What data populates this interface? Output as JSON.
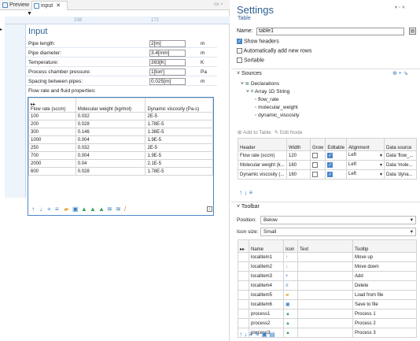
{
  "tabs": [
    {
      "label": "Preview"
    },
    {
      "label": "input"
    }
  ],
  "ruler": {
    "a": "238",
    "b": "172"
  },
  "form": {
    "title": "Input",
    "rows": [
      {
        "label": "Pipe length:",
        "value": "2[m]",
        "unit": "m"
      },
      {
        "label": "Pipe diameter:",
        "value": "3.4[mm]",
        "unit": "m"
      },
      {
        "label": "Temperature:",
        "value": "393[K]",
        "unit": "K"
      },
      {
        "label": "Process chamber pressure:",
        "value": "1[torr]",
        "unit": "Pa"
      },
      {
        "label": "Spacing between pipes:",
        "value": "0.025[m]",
        "unit": "m"
      }
    ],
    "flow_label": "Flow rate and fluid properties:"
  },
  "table": {
    "headers": [
      "Flow rate (sccm)",
      "Molecular weight (kg/mol)",
      "Dynamic viscosity (Pa-s)"
    ],
    "rows": [
      [
        "100",
        "0.032",
        "2E-5"
      ],
      [
        "200",
        "0.028",
        "1.78E-5"
      ],
      [
        "300",
        "0.146",
        "1.38E-5"
      ],
      [
        "1000",
        "0.004",
        "1.9E-5"
      ],
      [
        "250",
        "0.032",
        "2E-5"
      ],
      [
        "700",
        "0.004",
        "1.9E-5"
      ],
      [
        "2000",
        "0.04",
        "2.1E-5"
      ],
      [
        "600",
        "0.028",
        "1.78E-5"
      ]
    ]
  },
  "settings": {
    "title": "Settings",
    "subtitle": "Table",
    "name_label": "Name:",
    "name_value": "table1",
    "show_headers": "Show headers",
    "auto_add": "Automatically add new rows",
    "sortable": "Sortable",
    "sources": "Sources",
    "declarations": "Declarations",
    "array": "Array 1D String",
    "vars": [
      "flow_rate",
      "molecular_weight",
      "dynamic_viscosity"
    ],
    "add_to_table": "Add to Table",
    "edit_node": "Edit Node",
    "col_headers": [
      "Header",
      "Width",
      "Grow",
      "Editable",
      "Alignment",
      "Data source"
    ],
    "cols": [
      {
        "header": "Flow rate (sccm)",
        "width": "120",
        "align": "Left",
        "src": "Data 'flow_..."
      },
      {
        "header": "Molecular weight (k...",
        "width": "160",
        "align": "Left",
        "src": "Data 'mole..."
      },
      {
        "header": "Dynamic viscosity (...",
        "width": "160",
        "align": "Left",
        "src": "Data 'dyna..."
      }
    ],
    "toolbar": "Toolbar",
    "position_label": "Position:",
    "position_value": "Below",
    "iconsize_label": "Icon size:",
    "iconsize_value": "Small",
    "tb_headers": [
      "Name",
      "Icon",
      "Text",
      "Tooltip"
    ],
    "tb_rows": [
      {
        "name": "localitem1",
        "icon": "↑",
        "tip": "Move up"
      },
      {
        "name": "localitem2",
        "icon": "↓",
        "tip": "Move down"
      },
      {
        "name": "localitem3",
        "icon": "+",
        "tip": "Add"
      },
      {
        "name": "localitem4",
        "icon": "≡",
        "tip": "Delete"
      },
      {
        "name": "localitem5",
        "icon": "▰",
        "tip": "Load from file"
      },
      {
        "name": "localitem6",
        "icon": "▣",
        "tip": "Save to file"
      },
      {
        "name": "process1",
        "icon": "▲",
        "tip": "Process 1"
      },
      {
        "name": "process2",
        "icon": "▲",
        "tip": "Process 2"
      },
      {
        "name": "process3",
        "icon": "▲",
        "tip": "Process 3"
      }
    ]
  }
}
